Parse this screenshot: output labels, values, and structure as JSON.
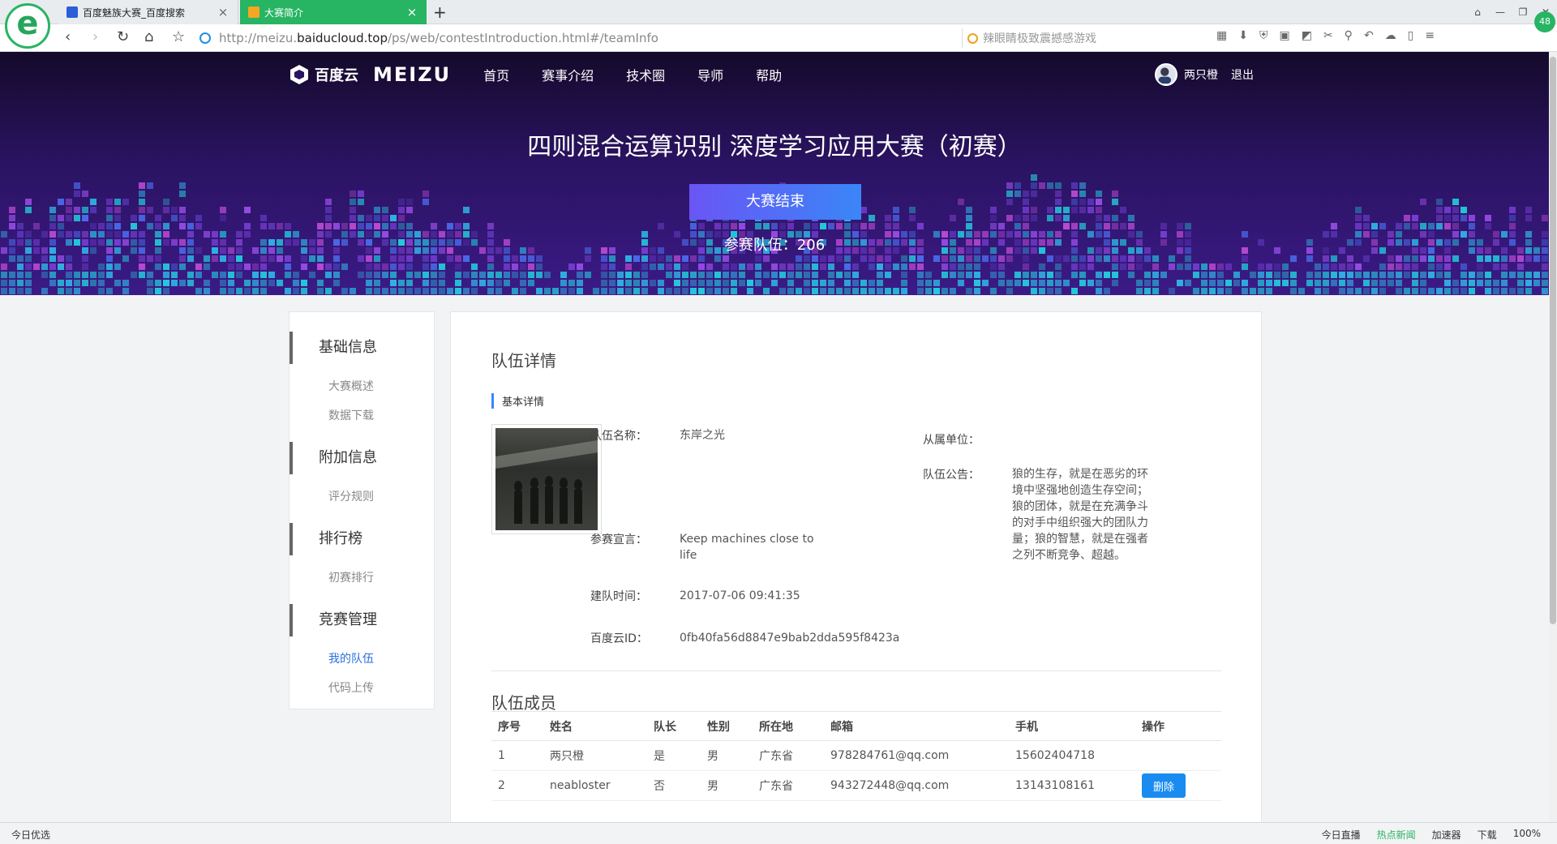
{
  "browser": {
    "logo_letter": "e",
    "tabs": [
      {
        "title": "百度魅族大赛_百度搜索"
      },
      {
        "title": "大赛简介"
      }
    ],
    "new_tab": "+",
    "url_prefix": "http://meizu.",
    "url_host": "baiducloud.top",
    "url_path": "/ps/web/contestIntroduction.html#/teamInfo",
    "search_placeholder": "辣眼睛极致震撼感游戏",
    "badge": "48"
  },
  "site": {
    "brand_baidu": "百度云",
    "brand_meizu": "MEIZU",
    "menu": [
      "首页",
      "赛事介绍",
      "技术圈",
      "导师",
      "帮助"
    ],
    "user_name": "两只橙",
    "logout": "退出"
  },
  "hero": {
    "title": "四则混合运算识别 深度学习应用大赛（初赛）",
    "button": "大赛结束",
    "team_count": "参赛队伍：206"
  },
  "sidebar": {
    "groups": [
      {
        "label": "基础信息",
        "items": [
          "大赛概述",
          "数据下载"
        ]
      },
      {
        "label": "附加信息",
        "items": [
          "评分规则"
        ]
      },
      {
        "label": "排行榜",
        "items": [
          "初赛排行"
        ]
      },
      {
        "label": "竞赛管理",
        "items": [
          "我的队伍",
          "代码上传"
        ]
      }
    ]
  },
  "team": {
    "panel_title": "队伍详情",
    "section": "基本详情",
    "name_label": "队伍名称：",
    "name": "东岸之光",
    "org_label": "从属单位：",
    "org": "",
    "notice_label": "队伍公告：",
    "notice": "狼的生存，就是在恶劣的环境中坚强地创造生存空间；狼的团体，就是在充满争斗的对手中组织强大的团队力量；狼的智慧，就是在强者之列不断竞争、超越。",
    "slogan_label": "参赛宣言：",
    "slogan": "Keep machines close to life",
    "created_label": "建队时间：",
    "created": "2017-07-06 09:41:35",
    "bid_label": "百度云ID：",
    "bid": "0fb40fa56d8847e9bab2dda595f8423a"
  },
  "members": {
    "title": "队伍成员",
    "headers": [
      "序号",
      "姓名",
      "队长",
      "性别",
      "所在地",
      "邮箱",
      "手机",
      "操作"
    ],
    "rows": [
      [
        "1",
        "两只橙",
        "是",
        "男",
        "广东省",
        "978284761@qq.com",
        "15602404718",
        ""
      ],
      [
        "2",
        "neabloster",
        "否",
        "男",
        "广东省",
        "943272448@qq.com",
        "13143108161",
        "删除"
      ]
    ]
  },
  "statusbar": {
    "left": "今日优选",
    "right": [
      "今日直播",
      "热点新闻",
      "加速器",
      "下载",
      "100%"
    ]
  }
}
